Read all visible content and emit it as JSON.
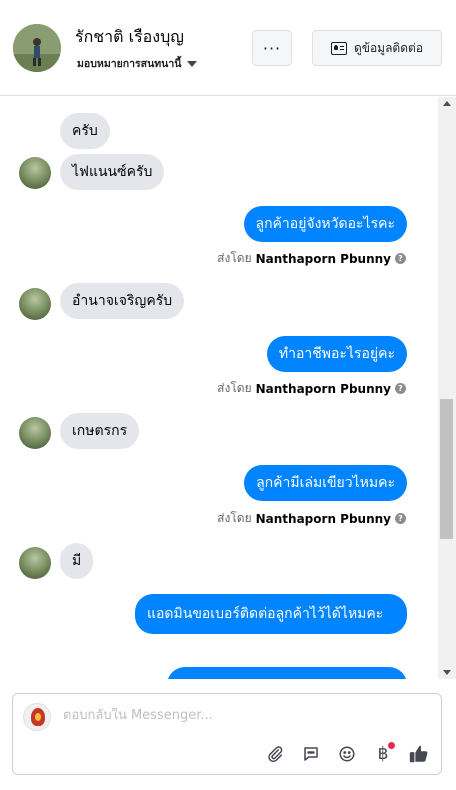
{
  "header": {
    "contact_name": "รักชาติ เรืองบุญ",
    "assign_label": "มอบหมายการสนทนานี้",
    "more_label": "···",
    "contact_info_label": "ดูข้อมูลติดต่อ"
  },
  "messages": [
    {
      "id": "m1",
      "direction": "in",
      "text": "ครับ"
    },
    {
      "id": "m2",
      "direction": "in",
      "text": "ไฟแนนซ์ครับ"
    },
    {
      "id": "m3",
      "direction": "out",
      "text": "ลูกค้าอยู่จังหวัดอะไรคะ",
      "sent_by_prefix": "ส่งโดย",
      "sent_by": "Nanthaporn Pbunny"
    },
    {
      "id": "m4",
      "direction": "in",
      "text": "อำนาจเจริญครับ"
    },
    {
      "id": "m5",
      "direction": "out",
      "text": "ทำอาชีพอะไรอยู่คะ",
      "sent_by_prefix": "ส่งโดย",
      "sent_by": "Nanthaporn Pbunny"
    },
    {
      "id": "m6",
      "direction": "in",
      "text": "เกษตรกร"
    },
    {
      "id": "m7",
      "direction": "out",
      "text": "ลูกค้ามีเล่มเขียวไหมคะ",
      "sent_by_prefix": "ส่งโดย",
      "sent_by": "Nanthaporn Pbunny"
    },
    {
      "id": "m8",
      "direction": "in",
      "text": "มี"
    },
    {
      "id": "m9",
      "direction": "out",
      "text": "แอดมินขอเบอร์ติดต่อลูกค้าไว้ได้ไหมคะ"
    }
  ],
  "composer": {
    "placeholder": "ตอบกลับใน Messenger...",
    "icons": [
      "paperclip-icon",
      "chat-icon",
      "smiley-icon",
      "baht-icon",
      "thumbs-up-icon"
    ],
    "baht_symbol": "฿"
  },
  "colors": {
    "outgoing_bubble": "#0084ff",
    "incoming_bubble": "#e4e6eb",
    "like_icon": "#444950",
    "notification_dot": "#f02849"
  }
}
